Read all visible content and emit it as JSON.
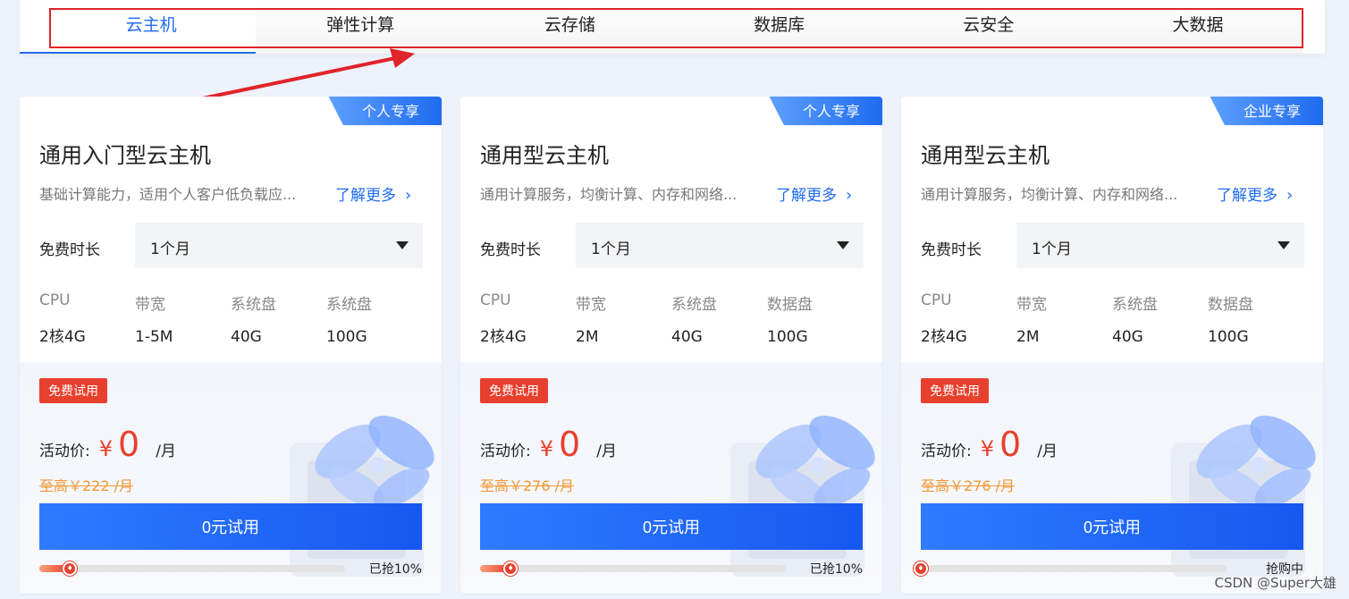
{
  "tabs": [
    {
      "label": "云主机",
      "active": true
    },
    {
      "label": "弹性计算",
      "active": false
    },
    {
      "label": "云存储",
      "active": false
    },
    {
      "label": "数据库",
      "active": false
    },
    {
      "label": "云安全",
      "active": false
    },
    {
      "label": "大数据",
      "active": false
    }
  ],
  "annotation": {
    "box_color": "#e0242a",
    "arrow_color": "#e0242a"
  },
  "cards": [
    {
      "badge": "个人专享",
      "title": "通用入门型云主机",
      "desc": "基础计算能力，适用个人客户低负载应...",
      "more": "了解更多",
      "duration_label": "免费时长",
      "duration_value": "1个月",
      "specs": [
        {
          "k": "CPU",
          "v": "2核4G"
        },
        {
          "k": "带宽",
          "v": "1-5M"
        },
        {
          "k": "系统盘",
          "v": "40G"
        },
        {
          "k": "系统盘",
          "v": "100G"
        }
      ],
      "trial_tag": "免费试用",
      "price_label": "活动价:",
      "currency": "¥",
      "price": "0",
      "per": "/月",
      "original_price": "至高￥222 /月",
      "button": "0元试用",
      "progress": 0.1,
      "progress_text": "已抢10%"
    },
    {
      "badge": "个人专享",
      "title": "通用型云主机",
      "desc": "通用计算服务，均衡计算、内存和网络...",
      "more": "了解更多",
      "duration_label": "免费时长",
      "duration_value": "1个月",
      "specs": [
        {
          "k": "CPU",
          "v": "2核4G"
        },
        {
          "k": "带宽",
          "v": "2M"
        },
        {
          "k": "系统盘",
          "v": "40G"
        },
        {
          "k": "数据盘",
          "v": "100G"
        }
      ],
      "trial_tag": "免费试用",
      "price_label": "活动价:",
      "currency": "¥",
      "price": "0",
      "per": "/月",
      "original_price": "至高￥276 /月",
      "button": "0元试用",
      "progress": 0.1,
      "progress_text": "已抢10%"
    },
    {
      "badge": "企业专享",
      "title": "通用型云主机",
      "desc": "通用计算服务，均衡计算、内存和网络...",
      "more": "了解更多",
      "duration_label": "免费时长",
      "duration_value": "1个月",
      "specs": [
        {
          "k": "CPU",
          "v": "2核4G"
        },
        {
          "k": "带宽",
          "v": "2M"
        },
        {
          "k": "系统盘",
          "v": "40G"
        },
        {
          "k": "数据盘",
          "v": "100G"
        }
      ],
      "trial_tag": "免费试用",
      "price_label": "活动价:",
      "currency": "¥",
      "price": "0",
      "per": "/月",
      "original_price": "至高￥276 /月",
      "button": "0元试用",
      "progress": 0,
      "progress_text": "抢购中"
    }
  ],
  "watermark": "CSDN @Super大雄",
  "colors": {
    "accent": "#1f6bf0",
    "price": "#e8402e",
    "original": "#f19a38"
  }
}
